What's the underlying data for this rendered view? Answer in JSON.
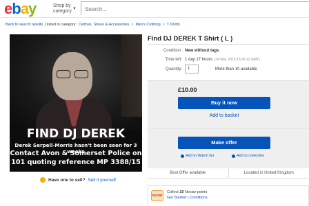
{
  "header": {
    "logo": [
      "e",
      "b",
      "a",
      "y"
    ],
    "shop_by": "Shop by category",
    "search_placeholder": "Search..."
  },
  "breadcrumb": {
    "back": "Back to search results",
    "listed_in": "| listed in category:",
    "path": [
      "Clothes, Shoes & Accessories",
      "Men's Clothing",
      "T-Shirts"
    ]
  },
  "photo": {
    "headline": "FIND DJ DEREK",
    "line1": "Derek Serpell-Morris hasn't been seen for 3 weeks",
    "line2": "Contact Avon & Somerset Police on",
    "line3": "101 quoting reference MP 3388/15"
  },
  "sell_own": {
    "prompt": "Have one to sell?",
    "link": "Sell it yourself"
  },
  "item": {
    "title": "Find DJ DEREK T Shirt ( L )",
    "condition_label": "Condition:",
    "condition_value": "New without tags",
    "time_left_label": "Time left:",
    "time_left_value": "1 day 17 hours",
    "time_left_stamp": "(24 Nov, 2015  15:06:12 GMT)",
    "quantity_label": "Quantity:",
    "quantity_value": "1",
    "availability": "More than 10 available"
  },
  "buy": {
    "price": "£10.00",
    "buy_now": "Buy it now",
    "add_basket": "Add to basket",
    "make_offer": "Make offer",
    "watch": "Add to Watch list",
    "collection": "Add to collection"
  },
  "info": {
    "best_offer": "Best Offer available",
    "location": "Located in United Kingdom"
  },
  "nectar": {
    "logo": "nectar",
    "line1_prefix": "Collect",
    "line1_bold": "10",
    "line1_suffix": "Nectar points",
    "line2": "Get Started | Conditions"
  }
}
